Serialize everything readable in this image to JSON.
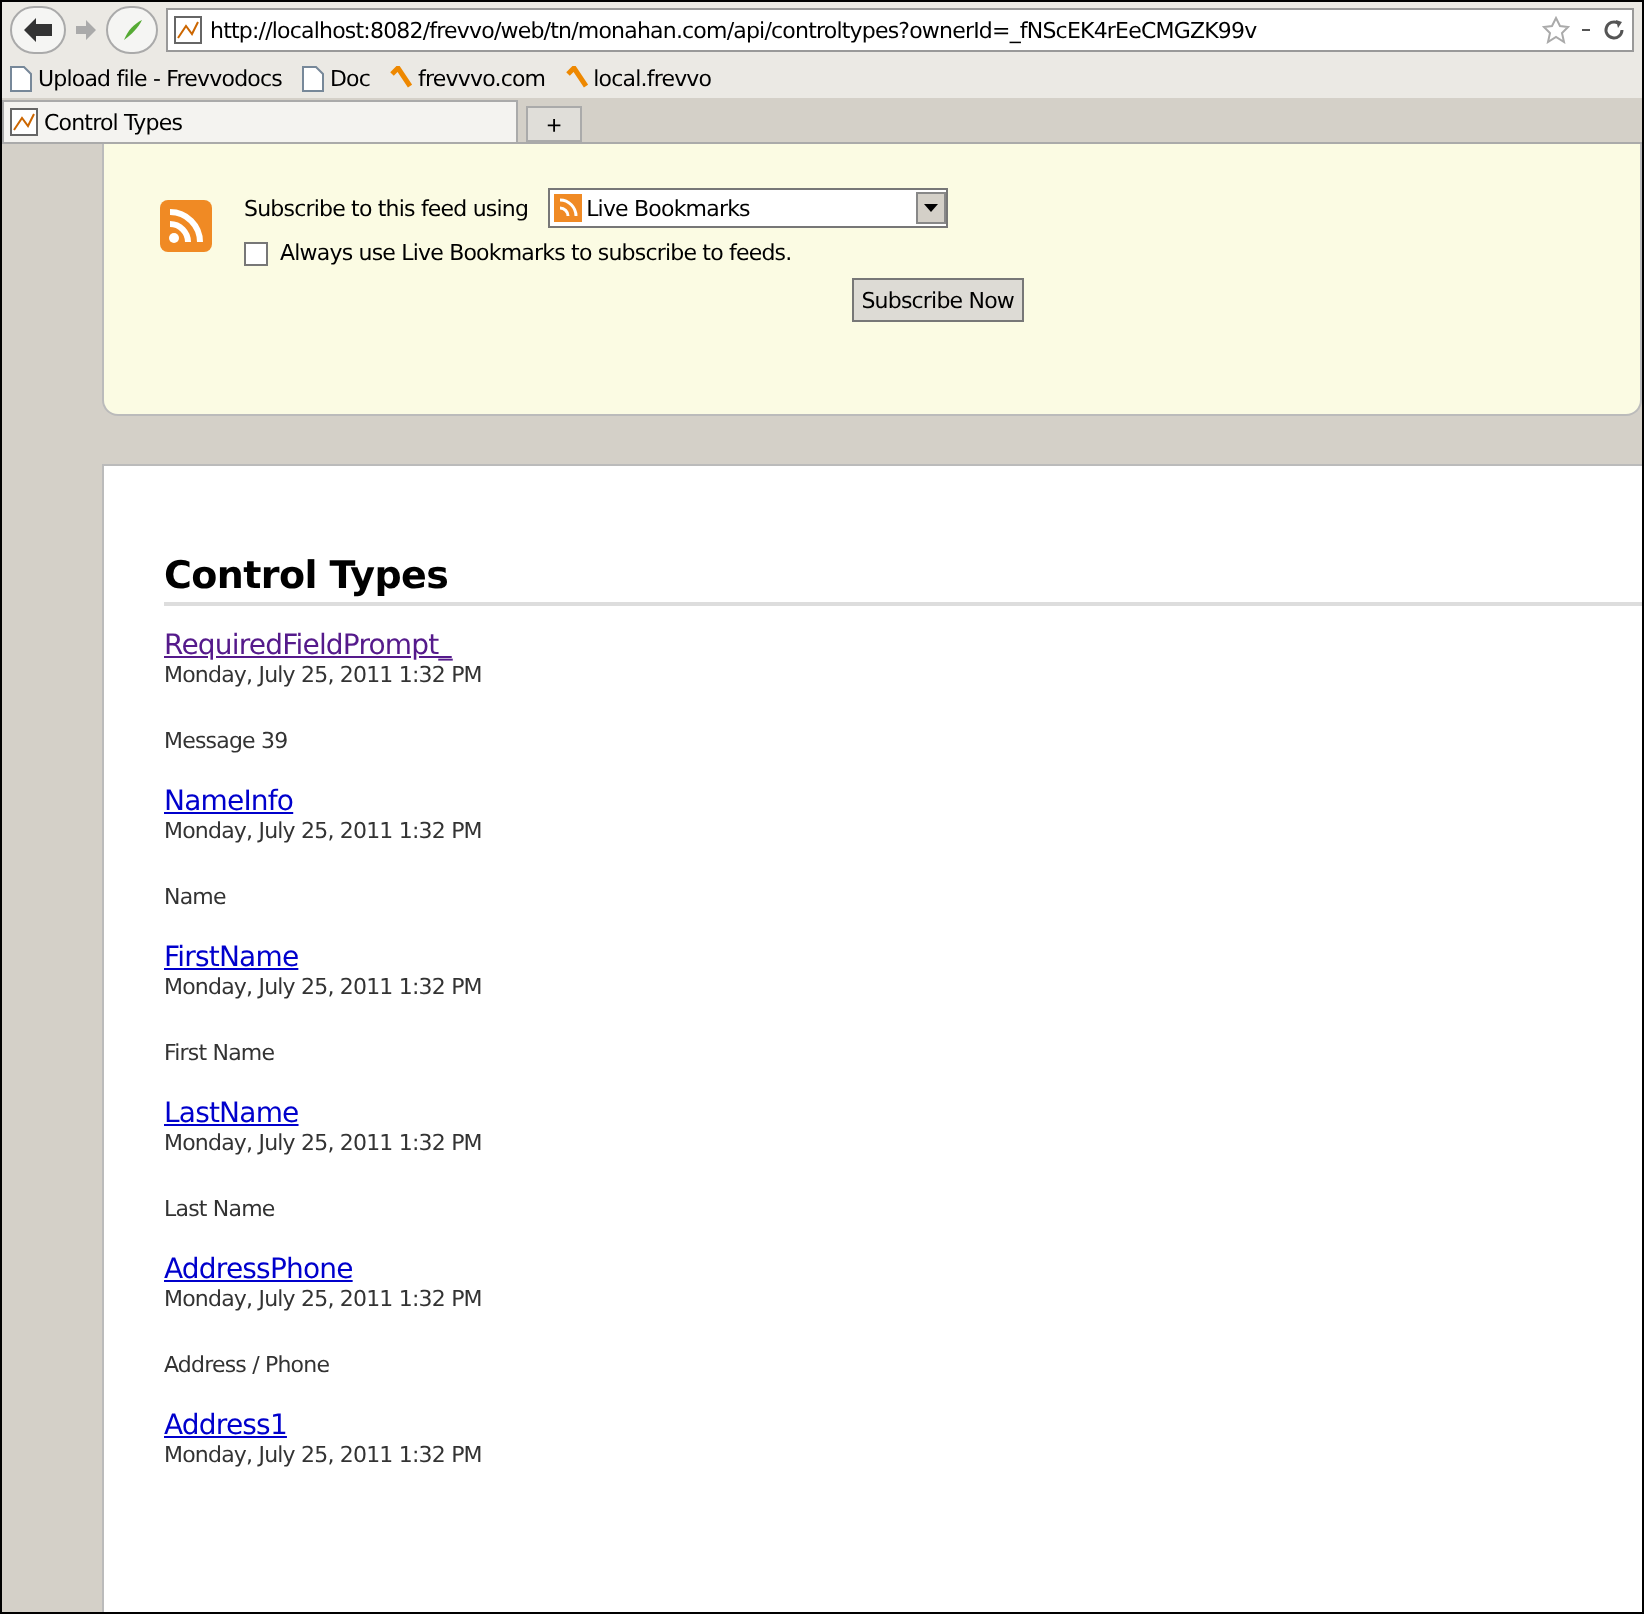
{
  "toolbar": {
    "url": "http://localhost:8082/frevvo/web/tn/monahan.com/api/controltypes?ownerId=_fNScEK4rEeCMGZK99v"
  },
  "bookmarks": [
    {
      "label": "Upload file - Frevvodocs",
      "kind": "page"
    },
    {
      "label": "Doc",
      "kind": "page"
    },
    {
      "label": "frevvvo.com",
      "kind": "feed"
    },
    {
      "label": "local.frevvo",
      "kind": "feed"
    }
  ],
  "tabs": [
    {
      "label": "Control Types",
      "selected": true
    },
    {
      "label": "+",
      "selected": false
    }
  ],
  "feed_box": {
    "prompt": "Subscribe to this feed using",
    "reader": "Live Bookmarks",
    "always_label": "Always use Live Bookmarks to subscribe to feeds.",
    "always_checked": false,
    "button": "Subscribe Now"
  },
  "heading": "Control Types",
  "entries": [
    {
      "title": "RequiredFieldPrompt_",
      "visited": true,
      "date": "Monday, July 25, 2011 1:32 PM",
      "description": "Message 39"
    },
    {
      "title": "NameInfo",
      "visited": false,
      "date": "Monday, July 25, 2011 1:32 PM",
      "description": "Name"
    },
    {
      "title": "FirstName",
      "visited": false,
      "date": "Monday, July 25, 2011 1:32 PM",
      "description": "First Name"
    },
    {
      "title": "LastName",
      "visited": false,
      "date": "Monday, July 25, 2011 1:32 PM",
      "description": "Last Name"
    },
    {
      "title": "AddressPhone",
      "visited": false,
      "date": "Monday, July 25, 2011 1:32 PM",
      "description": "Address / Phone"
    },
    {
      "title": "Address1",
      "visited": false,
      "date": "Monday, July 25, 2011 1:32 PM"
    }
  ]
}
